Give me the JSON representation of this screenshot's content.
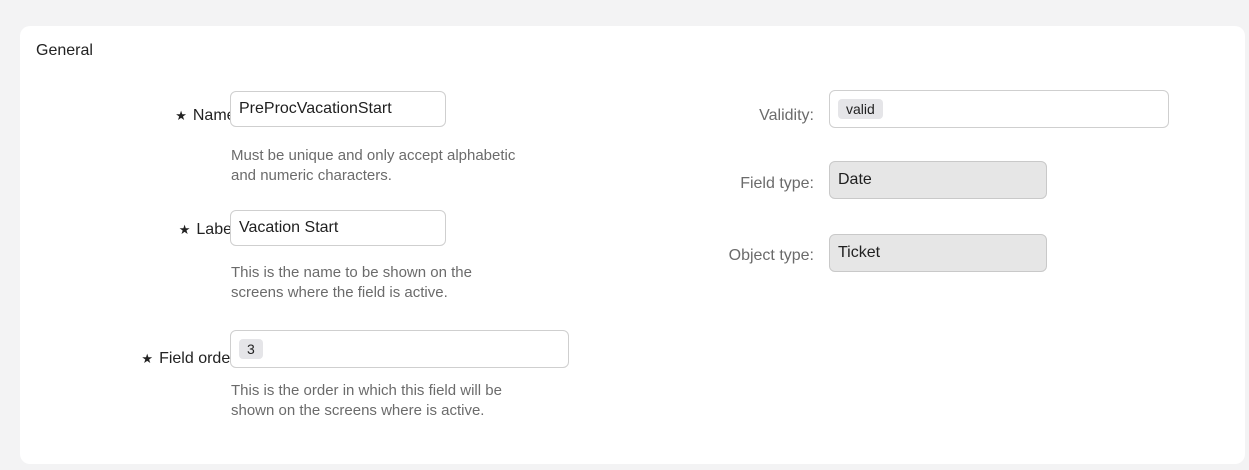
{
  "section": {
    "title": "General"
  },
  "fields": {
    "name": {
      "label": "Name:",
      "value": "PreProcVacationStart",
      "hint_line1": "Must be unique and only accept alphabetic",
      "hint_line2": "and numeric characters."
    },
    "label": {
      "label": "Label:",
      "value": "Vacation Start",
      "hint_line1": "This is the name to be shown on the",
      "hint_line2": "screens where the field is active."
    },
    "field_order": {
      "label": "Field order:",
      "value": "3",
      "hint_line1": "This is the order in which this field will be",
      "hint_line2": "shown on the screens where is active."
    },
    "validity": {
      "label": "Validity:",
      "value": "valid"
    },
    "field_type": {
      "label": "Field type:",
      "value": "Date"
    },
    "object_type": {
      "label": "Object type:",
      "value": "Ticket"
    }
  },
  "required_marker": "★"
}
